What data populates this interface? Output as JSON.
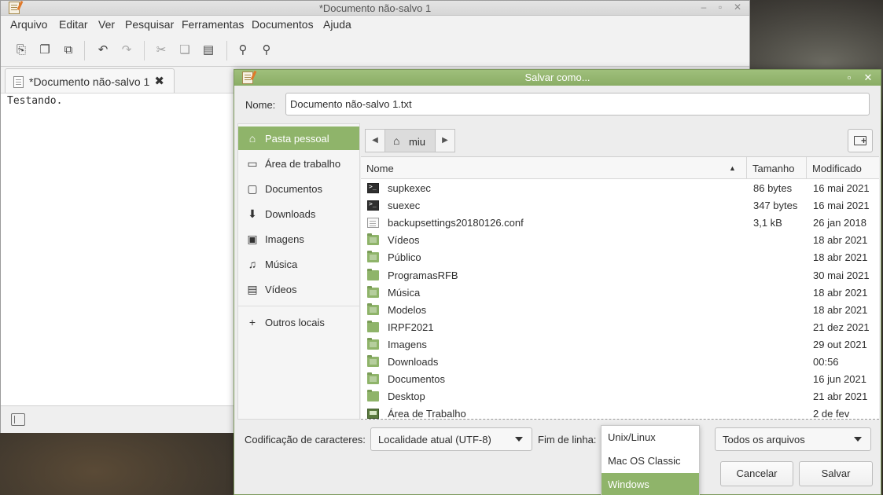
{
  "editor": {
    "title": "*Documento não-salvo 1",
    "menu": [
      "Arquivo",
      "Editar",
      "Ver",
      "Pesquisar",
      "Ferramentas",
      "Documentos",
      "Ajuda"
    ],
    "tab_label": "*Documento não-salvo 1",
    "tab_close": "✖",
    "content": "Testando.",
    "toolbar_icons": [
      "new-document-icon",
      "copy-document-icon",
      "paste-document-icon",
      "undo-icon",
      "redo-icon",
      "cut-icon",
      "copy-icon",
      "paste-icon",
      "find-icon",
      "find-replace-icon"
    ]
  },
  "dialog": {
    "title": "Salvar como...",
    "name_label": "Nome:",
    "name_value": "Documento não-salvo 1.txt",
    "places": [
      {
        "label": "Pasta pessoal",
        "icon": "⌂",
        "selected": true
      },
      {
        "label": "Área de trabalho",
        "icon": "▭"
      },
      {
        "label": "Documentos",
        "icon": "▢"
      },
      {
        "label": "Downloads",
        "icon": "⬇"
      },
      {
        "label": "Imagens",
        "icon": "▣"
      },
      {
        "label": "Música",
        "icon": "♫"
      },
      {
        "label": "Vídeos",
        "icon": "▤"
      },
      {
        "label": "Outros locais",
        "icon": "+"
      }
    ],
    "path": {
      "current": "miu"
    },
    "columns": {
      "name": "Nome",
      "size": "Tamanho",
      "modified": "Modificado"
    },
    "files": [
      {
        "name": "supkexec",
        "size": "86 bytes",
        "date": "16 mai 2021",
        "icon": "terminal"
      },
      {
        "name": "suexec",
        "size": "347 bytes",
        "date": "16 mai 2021",
        "icon": "terminal"
      },
      {
        "name": "backupsettings20180126.conf",
        "size": "3,1 kB",
        "date": "26 jan 2018",
        "icon": "text"
      },
      {
        "name": "Vídeos",
        "size": "",
        "date": "18 abr 2021",
        "icon": "folder"
      },
      {
        "name": "Público",
        "size": "",
        "date": "18 abr 2021",
        "icon": "folder"
      },
      {
        "name": "ProgramasRFB",
        "size": "",
        "date": "30 mai 2021",
        "icon": "folder-plain"
      },
      {
        "name": "Música",
        "size": "",
        "date": "18 abr 2021",
        "icon": "folder"
      },
      {
        "name": "Modelos",
        "size": "",
        "date": "18 abr 2021",
        "icon": "folder"
      },
      {
        "name": "IRPF2021",
        "size": "",
        "date": "21 dez 2021",
        "icon": "folder-plain"
      },
      {
        "name": "Imagens",
        "size": "",
        "date": "29 out 2021",
        "icon": "folder"
      },
      {
        "name": "Downloads",
        "size": "",
        "date": "00:56",
        "icon": "folder"
      },
      {
        "name": "Documentos",
        "size": "",
        "date": "16 jun 2021",
        "icon": "folder"
      },
      {
        "name": "Desktop",
        "size": "",
        "date": "21 abr 2021",
        "icon": "folder-plain"
      },
      {
        "name": "Área de Trabalho",
        "size": "",
        "date": "2 de fev",
        "icon": "desktop"
      }
    ],
    "encoding_label": "Codificação de caracteres:",
    "encoding_value": "Localidade atual (UTF-8)",
    "eol_label": "Fim de linha:",
    "eol_options": [
      "Unix/Linux",
      "Mac OS Classic",
      "Windows"
    ],
    "eol_selected": "Windows",
    "filter_value": "Todos os arquivos",
    "cancel_label": "Cancelar",
    "save_label": "Salvar"
  },
  "colors": {
    "accent": "#8fb46a",
    "titlebar_active": "#9fbf7b"
  }
}
